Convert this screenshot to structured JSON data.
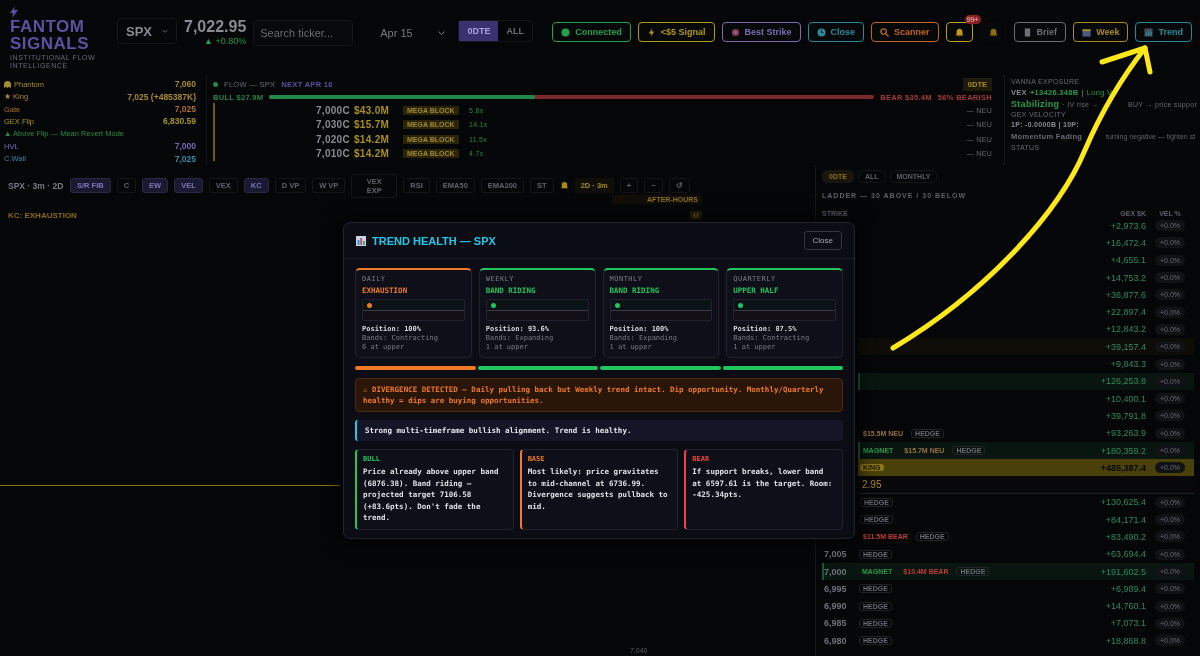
{
  "header": {
    "brand": "FANTOM SIGNALS",
    "tagline": "INSTITUTIONAL FLOW INTELLIGENCE",
    "ticker": "SPX",
    "price": "7,022.95",
    "change": "▲ +0.80%",
    "search": {
      "placeholder": "Search ticker..."
    },
    "date": "Apr 15",
    "expiry_tabs": [
      {
        "label": "0DTE",
        "selected": true
      },
      {
        "label": "ALL",
        "selected": false
      }
    ],
    "buttons": [
      {
        "kind": "dot",
        "label": "Connected",
        "color": "#22a04d"
      },
      {
        "kind": "bolt",
        "label": "<$5 Signal",
        "color": "#b09a1c"
      },
      {
        "kind": "target",
        "label": "Best Strike",
        "color": "#7a6cb0"
      },
      {
        "kind": "clock",
        "label": "Close",
        "color": "#2a8a9a"
      },
      {
        "kind": "search",
        "label": "Scanner",
        "color": "#c0642a"
      },
      {
        "kind": "bell",
        "badge": "99+",
        "color": "#c09a18"
      },
      {
        "kind": "bell",
        "color": "#8a7014"
      },
      {
        "kind": "doc",
        "label": "Brief",
        "color": "#6e6e76"
      },
      {
        "kind": "calendar",
        "label": "Week",
        "color": "#a88e1c"
      },
      {
        "kind": "chart",
        "label": "Trend",
        "color": "#2a8a9a"
      }
    ]
  },
  "levels": [
    {
      "kind": "ghost",
      "label": "Phantom",
      "value": "7,060",
      "color": "#a88a30"
    },
    {
      "kind": "plain",
      "label": "★ King",
      "value": "7,025 (+485387K)",
      "color": "#a88a30"
    },
    {
      "kind": "plain",
      "label": "Gate",
      "value": "7,025",
      "color": "#b0702a"
    },
    {
      "kind": "plain",
      "label": "GEX Flip",
      "value": "6,830.59",
      "color": "#a8961e"
    },
    {
      "kind": "note",
      "label": "▲ Above Flip — Mean Revert Mode",
      "color": "#2a8a48"
    },
    {
      "kind": "plain",
      "label": "HVL",
      "value": "7,000",
      "color": "#7a68b8"
    },
    {
      "kind": "plain",
      "label": "C.Wall",
      "value": "7,025",
      "color": "#3a8aa8"
    }
  ],
  "flow": {
    "title": "FLOW — SPX",
    "next": "NEXT APR 16",
    "badge": "0DTE",
    "bull": "BULL $27.9M",
    "bear": "BEAR $35.4M",
    "bias": "56% BEARISH",
    "level": 0.44,
    "rows": [
      {
        "strike": "7,000C",
        "premium": "$43.0M",
        "tag": "MEGA BLOCK",
        "ratio": "5.8x",
        "side": "— NEU"
      },
      {
        "strike": "7,030C",
        "premium": "$15.7M",
        "tag": "MEGA BLOCK",
        "ratio": "14.1x",
        "side": "— NEU"
      },
      {
        "strike": "7,020C",
        "premium": "$14.2M",
        "tag": "MEGA BLOCK",
        "ratio": "11.5x",
        "side": "— NEU"
      },
      {
        "strike": "7,010C",
        "premium": "$14.2M",
        "tag": "MEGA BLOCK",
        "ratio": "4.7x",
        "side": "— NEU"
      }
    ]
  },
  "vanna": {
    "title": "VANNA EXPOSURE",
    "vex_label": "VEX",
    "vex_value": "+13426.348B",
    "separator": "|",
    "vex_mode": "Long V",
    "state": "Stabilizing",
    "state_note": "· IV rise →",
    "state_note_tail": "BUY → price suppor",
    "velocity_title": "GEX VELOCITY",
    "velocity": "1P: -0.0000B | 10P:",
    "momentum": "Momentum Fading",
    "momentum_note": "turning negative — tighten st",
    "status_title": "STATUS"
  },
  "chart": {
    "symbol": "SPX · 3m · 2D",
    "tools": [
      {
        "label": "S/R FIB",
        "selected": true
      },
      {
        "label": "C",
        "selected": false
      },
      {
        "label": "EW",
        "selected": true
      },
      {
        "label": "VEL",
        "selected": true
      },
      {
        "label": "VEX",
        "selected": false
      },
      {
        "label": "KC",
        "selected": true
      },
      {
        "label": "D VP",
        "selected": false
      },
      {
        "label": "W VP",
        "selected": false
      },
      {
        "label": "VEX EXP",
        "selected": false
      },
      {
        "label": "RSI",
        "selected": false
      },
      {
        "label": "EMA50",
        "selected": false
      },
      {
        "label": "EMA200",
        "selected": false
      },
      {
        "label": "ST",
        "selected": false
      }
    ],
    "timeframe": "2D · 3m",
    "zoom": [
      "+",
      "−",
      "↺"
    ],
    "signal": "KC: EXHAUSTION",
    "session": "AFTER-HOURS",
    "marker": "M",
    "axis_label": "7,040"
  },
  "ladder": {
    "tabs": [
      {
        "label": "0DTE",
        "selected": true
      },
      {
        "label": "ALL",
        "selected": false
      },
      {
        "label": "MONTHLY",
        "selected": false
      }
    ],
    "title": "LADDER — 30 ABOVE / 30 BELOW",
    "columns": [
      "STRIKE",
      "GEX $K",
      "VEL %"
    ],
    "price_tail": "2.95",
    "rows": [
      {
        "kind": "plain",
        "gex": "+2,973.6",
        "vel": "+0.0%"
      },
      {
        "kind": "plain",
        "gex": "+16,472.4",
        "vel": "+0.0%"
      },
      {
        "kind": "plain",
        "gex": "+4,655.1",
        "vel": "+0.0%"
      },
      {
        "kind": "plain",
        "gex": "+14,753.2",
        "vel": "+0.0%"
      },
      {
        "kind": "plain",
        "gex": "+36,877.6",
        "vel": "+0.0%"
      },
      {
        "kind": "plain",
        "gex": "+22,897.4",
        "vel": "+0.0%"
      },
      {
        "kind": "plain",
        "gex": "+12,843.2",
        "vel": "+0.0%"
      },
      {
        "kind": "gate",
        "gex": "+39,157.4",
        "vel": "+0.0%"
      },
      {
        "kind": "plain",
        "gex": "+9,843.3",
        "vel": "+0.0%"
      },
      {
        "kind": "wall",
        "gex": "+126,253.8",
        "vel": "+0.0%"
      },
      {
        "kind": "plain",
        "gex": "+10,400.1",
        "vel": "+0.0%"
      },
      {
        "kind": "plain",
        "gex": "+39,791.8",
        "vel": "+0.0%"
      },
      {
        "kind": "plain",
        "tags": [
          {
            "kind": "neu",
            "text": "$15.5M NEU"
          },
          {
            "kind": "hedge",
            "text": "HEDGE"
          }
        ],
        "gex": "+93,263.9",
        "vel": "+0.0%"
      },
      {
        "kind": "wall",
        "tags": [
          {
            "kind": "magnet",
            "text": "MAGNET"
          },
          {
            "kind": "neu",
            "text": "$15.7M NEU"
          },
          {
            "kind": "hedge",
            "text": "HEDGE"
          }
        ],
        "gex": "+180,359.2",
        "vel": "+0.0%"
      },
      {
        "kind": "king",
        "tags": [
          {
            "kind": "king",
            "text": "KING"
          }
        ],
        "gex": "+485,387.4",
        "vel": "+0.0%"
      },
      {
        "kind": "price"
      },
      {
        "kind": "plain",
        "tags": [
          {
            "kind": "hedge",
            "text": "HEDGE"
          }
        ],
        "gex": "+130,625.4",
        "vel": "+0.0%"
      },
      {
        "kind": "plain",
        "tags": [
          {
            "kind": "hedge",
            "text": "HEDGE"
          }
        ],
        "gex": "+84,171.4",
        "vel": "+0.0%"
      },
      {
        "kind": "plain",
        "tags": [
          {
            "kind": "bear",
            "text": "$11.5M BEAR"
          },
          {
            "kind": "hedge",
            "text": "HEDGE"
          }
        ],
        "gex": "+83,490.2",
        "vel": "+0.0%"
      },
      {
        "kind": "plain",
        "strike": "7,005",
        "tags": [
          {
            "kind": "hedge",
            "text": "HEDGE"
          }
        ],
        "gex": "+63,694.4",
        "vel": "+0.0%"
      },
      {
        "kind": "wall",
        "strike": "7,000",
        "tags": [
          {
            "kind": "magnet",
            "text": "MAGNET"
          },
          {
            "kind": "bear",
            "text": "$10.4M BEAR"
          },
          {
            "kind": "hedge",
            "text": "HEDGE"
          }
        ],
        "gex": "+191,602.5",
        "vel": "+0.0%"
      },
      {
        "kind": "plain",
        "strike": "6,995",
        "tags": [
          {
            "kind": "hedge",
            "text": "HEDGE"
          }
        ],
        "gex": "+6,989.4",
        "vel": "+0.0%"
      },
      {
        "kind": "plain",
        "strike": "6,990",
        "tags": [
          {
            "kind": "hedge",
            "text": "HEDGE"
          }
        ],
        "gex": "+14,760.1",
        "vel": "+0.0%"
      },
      {
        "kind": "plain",
        "strike": "6,985",
        "tags": [
          {
            "kind": "hedge",
            "text": "HEDGE"
          }
        ],
        "gex": "+7,073.1",
        "vel": "+0.0%"
      },
      {
        "kind": "plain",
        "strike": "6,980",
        "tags": [
          {
            "kind": "hedge",
            "text": "HEDGE"
          }
        ],
        "gex": "+18,868.8",
        "vel": "+0.0%"
      }
    ]
  },
  "modal": {
    "title": "TREND HEALTH — SPX",
    "close": "Close",
    "timeframes": [
      {
        "label": "DAILY",
        "state": "EXHAUSTION",
        "color": "#f07a28",
        "position": "Position: 100%",
        "bands": "Bands: Contracting",
        "upper": "6 at upper"
      },
      {
        "label": "WEEKLY",
        "state": "BAND RIDING",
        "color": "#22c55e",
        "position": "Position: 93.6%",
        "bands": "Bands: Expanding",
        "upper": "1 at upper"
      },
      {
        "label": "MONTHLY",
        "state": "BAND RIDING",
        "color": "#22c55e",
        "position": "Position: 100%",
        "bands": "Bands: Expanding",
        "upper": "1 at upper"
      },
      {
        "label": "QUARTERLY",
        "state": "UPPER HALF",
        "color": "#22c55e",
        "position": "Position: 87.5%",
        "bands": "Bands: Contracting",
        "upper": "1 at upper"
      }
    ],
    "alert": "⚠ DIVERGENCE DETECTED — Daily pulling back but Weekly trend intact. Dip opportunity. Monthly/Quarterly healthy = dips are buying opportunities.",
    "summary": "Strong multi-timeframe bullish alignment. Trend is healthy.",
    "scenarios": [
      {
        "label": "BULL",
        "color": "#22c55e",
        "text": "Price already above upper band (6876.38). Band riding — projected target 7106.58 (+83.6pts). Don't fade the trend."
      },
      {
        "label": "BASE",
        "color": "#f07a28",
        "text": "Most likely: price gravitates to mid-channel at 6736.99. Divergence suggests pullback to mid."
      },
      {
        "label": "BEAR",
        "color": "#ef4444",
        "text": "If support breaks, lower band at 6597.61 is the target. Room: -425.34pts."
      }
    ]
  }
}
